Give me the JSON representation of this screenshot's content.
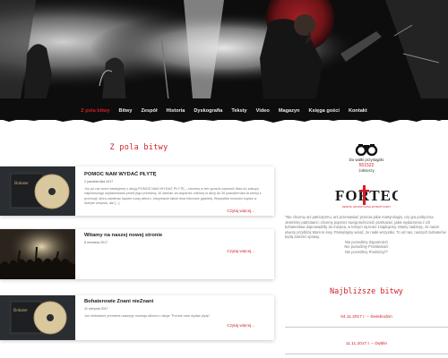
{
  "nav": {
    "items": [
      "Z pola bitwy",
      "Bitwy",
      "Zespół",
      "Historia",
      "Dyskografia",
      "Teksty",
      "Video",
      "Magazyn",
      "Księga gości",
      "Kontakt"
    ]
  },
  "main": {
    "section_title": "Z pola bitwy",
    "posts": [
      {
        "title": "POMOC NAM WYDAĆ PŁYTĘ",
        "date": "2 października 2017",
        "excerpt": "Już po raz trzeci startujemy z akcją POMOŻ NAM WYDAĆ PŁYTĘ – chcemy w ten sposób zaprosić Was do zakupu najnowszego wydawnictwa przed jego premierą. W zamian za wsparcie odbiorę w akcji do 30 października ta wersji z promocji, która zawierać będzie nowy album, otrzymacie także dwa fotorowe gadżety. Wszystkie nowości kupisz w sklepie zespołu, ale [...]",
        "more": "Czytaj więcej..."
      },
      {
        "title": "Witamy na naszej nowej stronie",
        "date": "8 września 2017",
        "excerpt": "",
        "more": "Czytaj więcej..."
      },
      {
        "title": "Bohaterowie Znani nieZnani",
        "date": "31 sierpnia 2017",
        "excerpt": "Już niebawem premiera naszego nowego albumu i akcja \"Pomóż nam wydać płytę\"",
        "more": "Czytaj więcej..."
      }
    ]
  },
  "sidebar": {
    "line1": "Do walki przystąpiło",
    "count": "551522",
    "line2": "żołnierzy",
    "logo_text": "FORTECA",
    "logo_sub": "ZESPÓŁ HISTORYCZNO-PATRIOTYCZNY",
    "quote": "\"Nie chcemy ani patriotyzmu, ani przemawiać przeciw jakie martyrologia, czy gra polityczna. Jesteśmy patriotami i chcemy poprzez swoją twórczość przekazać, jakie wydarzenia z ich bohaterstwa doprowadziły do miejsca, w którym są teraz znajdujemy. Mamy nadzieję, że nasze utwory przybliżą Wam te losy. Pamiętajmy wciąż, że nade wszystko: To od nas, naszych bohaterów będą zależeć sprawy.",
    "closing": [
      "Nie pozwólmy Zapomnieć!",
      "Nie pozwólmy Przekłamać!",
      "Nie pozwólmy Powtórzyć!\""
    ],
    "battles_heading": "Najbliższe bitwy",
    "battles": [
      "04.11.2017 r. – Świebodzin",
      "11.11.2017 r. – Dęblin"
    ]
  },
  "colors": {
    "accent": "#d11f24",
    "hero_bg": "#0d0d0d"
  }
}
